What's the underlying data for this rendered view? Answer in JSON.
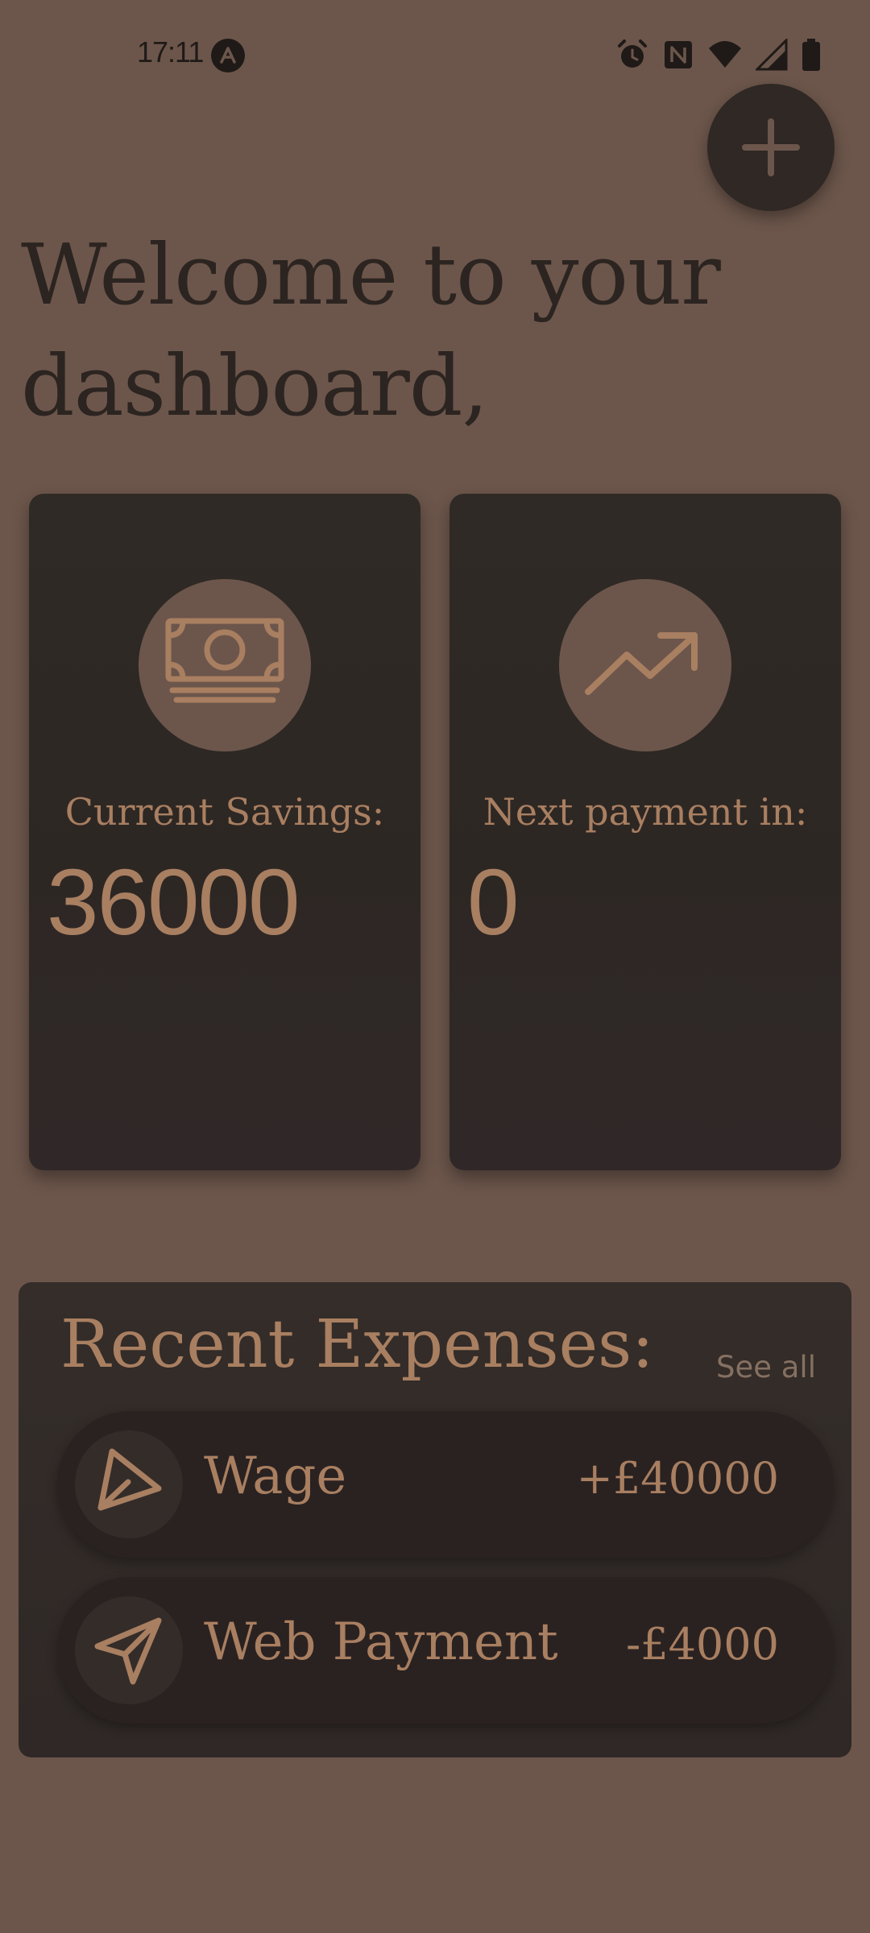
{
  "status_bar": {
    "time": "17:11",
    "icons": [
      "app-notification-icon",
      "alarm-icon",
      "nfc-icon",
      "wifi-icon",
      "cell-signal-icon",
      "battery-icon"
    ]
  },
  "fab": {
    "icon": "plus-icon"
  },
  "header": {
    "title": "Welcome to your dashboard,"
  },
  "cards": [
    {
      "icon": "cash-icon",
      "label": "Current Savings:",
      "value": "36000"
    },
    {
      "icon": "trending-up-icon",
      "label": "Next payment in:",
      "value": "0"
    }
  ],
  "recent_expenses": {
    "title": "Recent Expenses:",
    "see_all_label": "See all",
    "items": [
      {
        "icon": "send-outline-icon",
        "name": "Wage",
        "amount": "+£40000"
      },
      {
        "icon": "send-icon",
        "name": "Web Payment",
        "amount": "-£4000"
      }
    ]
  },
  "colors": {
    "background": "#6c564b",
    "card": "#2f2925",
    "accent_text": "#a97f61",
    "title_text": "#2c2420"
  }
}
